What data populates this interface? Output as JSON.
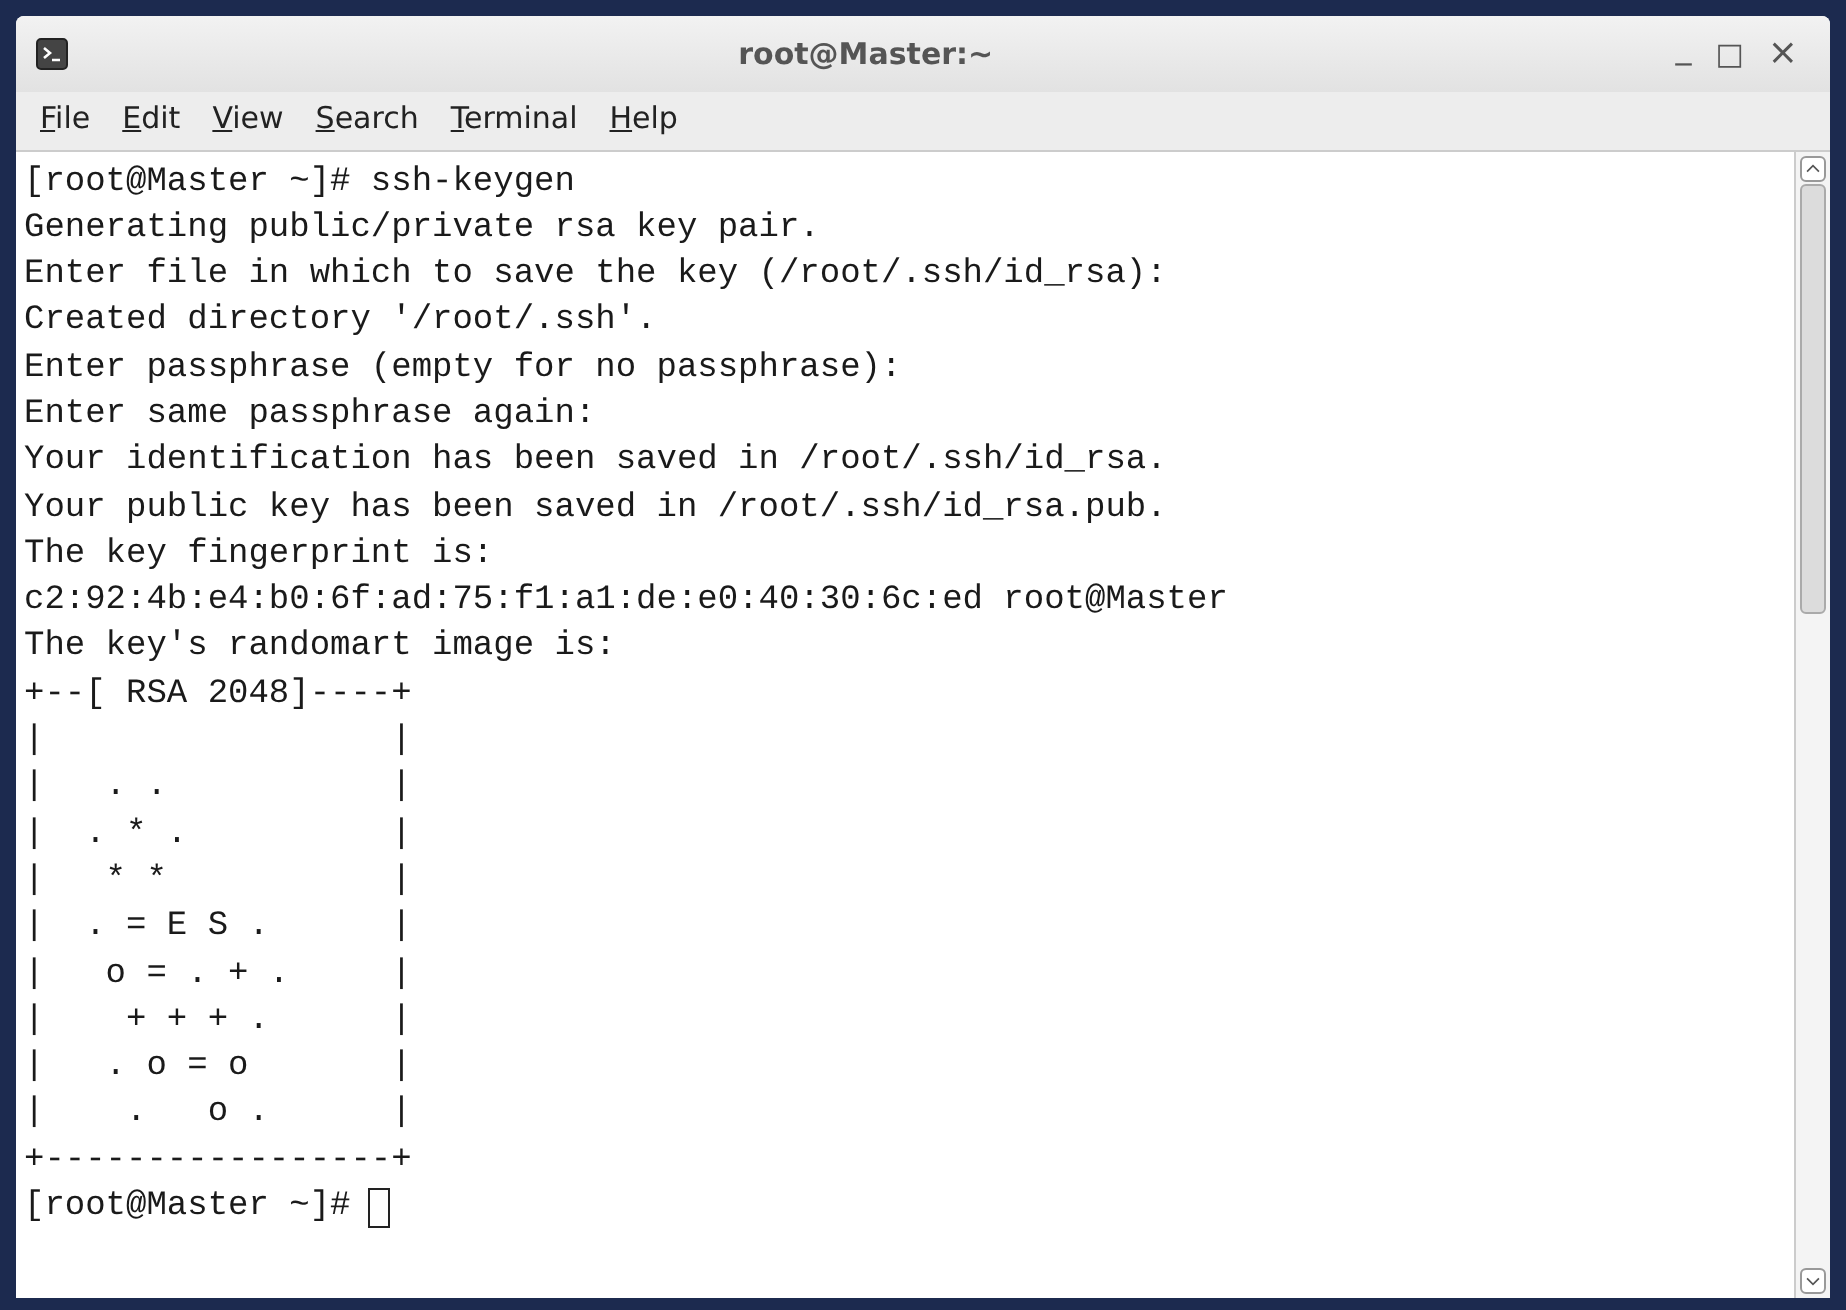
{
  "window": {
    "title": "root@Master:~",
    "controls": [
      {
        "kind": "minimize",
        "glyph": "_"
      },
      {
        "kind": "maximize",
        "glyph": "□"
      },
      {
        "kind": "close",
        "glyph": "×"
      }
    ]
  },
  "menu": [
    {
      "accel": "F",
      "rest": "ile"
    },
    {
      "accel": "E",
      "rest": "dit"
    },
    {
      "accel": "V",
      "rest": "iew"
    },
    {
      "accel": "S",
      "rest": "earch"
    },
    {
      "accel": "T",
      "rest": "erminal"
    },
    {
      "accel": "H",
      "rest": "elp"
    }
  ],
  "terminal": {
    "lines": [
      "[root@Master ~]# ssh-keygen",
      "Generating public/private rsa key pair.",
      "Enter file in which to save the key (/root/.ssh/id_rsa):",
      "Created directory '/root/.ssh'.",
      "Enter passphrase (empty for no passphrase):",
      "Enter same passphrase again:",
      "Your identification has been saved in /root/.ssh/id_rsa.",
      "Your public key has been saved in /root/.ssh/id_rsa.pub.",
      "The key fingerprint is:",
      "c2:92:4b:e4:b0:6f:ad:75:f1:a1:de:e0:40:30:6c:ed root@Master",
      "The key's randomart image is:",
      "+--[ RSA 2048]----+",
      "|                 |",
      "|   . .           |",
      "|  . * .          |",
      "|   * *           |",
      "|  . = E S .      |",
      "|   o = . + .     |",
      "|    + + + .      |",
      "|   . o = o       |",
      "|    .   o .      |",
      "+-----------------+"
    ],
    "prompt": "[root@Master ~]#",
    "cursor_visible": true
  }
}
